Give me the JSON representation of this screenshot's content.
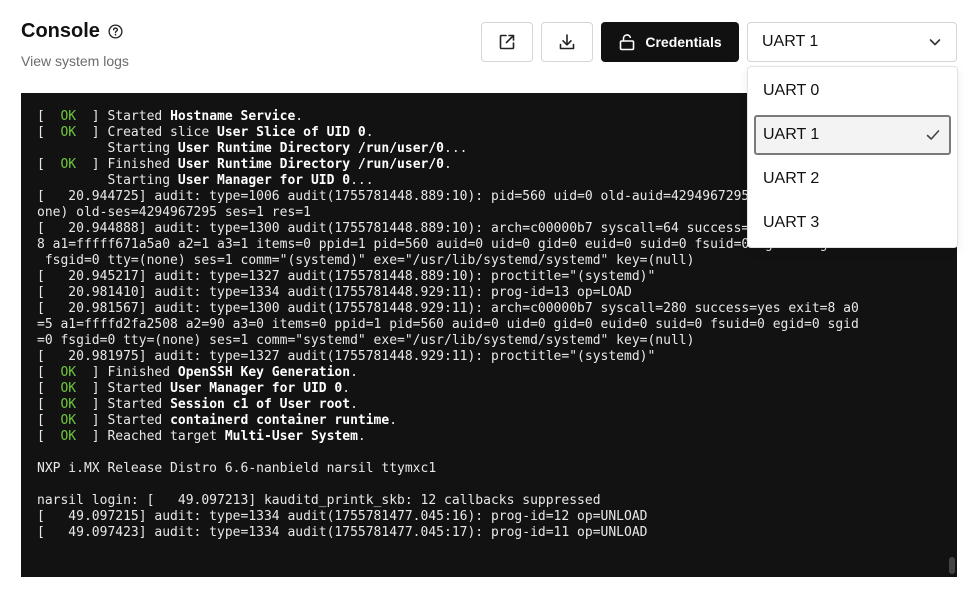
{
  "header": {
    "title": "Console",
    "subtitle": "View system logs"
  },
  "icons": {
    "help": "help-circle-icon",
    "open": "external-link-icon",
    "download": "download-icon",
    "credentials": "unlock-icon",
    "dropdown": "chevron-down-icon",
    "check": "check-icon"
  },
  "toolbar": {
    "credentials_label": "Credentials",
    "port_selected": "UART 1"
  },
  "dropdown": {
    "options": [
      "UART 0",
      "UART 1",
      "UART 2",
      "UART 3"
    ],
    "selected": "UART 1"
  },
  "colors": {
    "ok_green": "#6fc83c",
    "terminal_bg": "#121212",
    "primary_button": "#111111"
  },
  "console": {
    "lines": [
      [
        {
          "t": "[  "
        },
        {
          "t": "OK",
          "s": "ok"
        },
        {
          "t": "  ] Started "
        },
        {
          "t": "Hostname Service",
          "s": "b"
        },
        {
          "t": "."
        }
      ],
      [
        {
          "t": "[  "
        },
        {
          "t": "OK",
          "s": "ok"
        },
        {
          "t": "  ] Created slice "
        },
        {
          "t": "User Slice of UID 0",
          "s": "b"
        },
        {
          "t": "."
        }
      ],
      [
        {
          "t": "         Starting "
        },
        {
          "t": "User Runtime Directory /run/user/0",
          "s": "b"
        },
        {
          "t": "..."
        }
      ],
      [
        {
          "t": "[  "
        },
        {
          "t": "OK",
          "s": "ok"
        },
        {
          "t": "  ] Finished "
        },
        {
          "t": "User Runtime Directory /run/user/0",
          "s": "b"
        },
        {
          "t": "."
        }
      ],
      [
        {
          "t": "         Starting "
        },
        {
          "t": "User Manager for UID 0",
          "s": "b"
        },
        {
          "t": "..."
        }
      ],
      [
        {
          "t": "[   20.944725] audit: type=1006 audit(1755781448.889:10): pid=560 uid=0 old-auid=4294967295 auid=0 tty=(n"
        }
      ],
      [
        {
          "t": "one) old-ses=4294967295 ses=1 res=1"
        }
      ],
      [
        {
          "t": "[   20.944888] audit: type=1300 audit(1755781448.889:10): arch=c00000b7 syscall=64 success=yes exit=1 a0=8"
        }
      ],
      [
        {
          "t": "8 a1=fffff671a5a0 a2=1 a3=1 items=0 ppid=1 pid=560 auid=0 uid=0 gid=0 euid=0 suid=0 fsuid=0 egid=0 sgid=0"
        }
      ],
      [
        {
          "t": " fsgid=0 tty=(none) ses=1 comm=\"(systemd)\" exe=\"/usr/lib/systemd/systemd\" key=(null)"
        }
      ],
      [
        {
          "t": "[   20.945217] audit: type=1327 audit(1755781448.889:10): proctitle=\"(systemd)\""
        }
      ],
      [
        {
          "t": "[   20.981410] audit: type=1334 audit(1755781448.929:11): prog-id=13 op=LOAD"
        }
      ],
      [
        {
          "t": "[   20.981567] audit: type=1300 audit(1755781448.929:11): arch=c00000b7 syscall=280 success=yes exit=8 a0"
        }
      ],
      [
        {
          "t": "=5 a1=ffffd2fa2508 a2=90 a3=0 items=0 ppid=1 pid=560 auid=0 uid=0 gid=0 euid=0 suid=0 fsuid=0 egid=0 sgid"
        }
      ],
      [
        {
          "t": "=0 fsgid=0 tty=(none) ses=1 comm=\"systemd\" exe=\"/usr/lib/systemd/systemd\" key=(null)"
        }
      ],
      [
        {
          "t": "[   20.981975] audit: type=1327 audit(1755781448.929:11): proctitle=\"(systemd)\""
        }
      ],
      [
        {
          "t": "[  "
        },
        {
          "t": "OK",
          "s": "ok"
        },
        {
          "t": "  ] Finished "
        },
        {
          "t": "OpenSSH Key Generation",
          "s": "b"
        },
        {
          "t": "."
        }
      ],
      [
        {
          "t": "[  "
        },
        {
          "t": "OK",
          "s": "ok"
        },
        {
          "t": "  ] Started "
        },
        {
          "t": "User Manager for UID 0",
          "s": "b"
        },
        {
          "t": "."
        }
      ],
      [
        {
          "t": "[  "
        },
        {
          "t": "OK",
          "s": "ok"
        },
        {
          "t": "  ] Started "
        },
        {
          "t": "Session c1 of User root",
          "s": "b"
        },
        {
          "t": "."
        }
      ],
      [
        {
          "t": "[  "
        },
        {
          "t": "OK",
          "s": "ok"
        },
        {
          "t": "  ] Started "
        },
        {
          "t": "containerd container runtime",
          "s": "b"
        },
        {
          "t": "."
        }
      ],
      [
        {
          "t": "[  "
        },
        {
          "t": "OK",
          "s": "ok"
        },
        {
          "t": "  ] Reached target "
        },
        {
          "t": "Multi-User System",
          "s": "b"
        },
        {
          "t": "."
        }
      ],
      [
        {
          "t": ""
        }
      ],
      [
        {
          "t": "NXP i.MX Release Distro 6.6-nanbield narsil ttymxc1"
        }
      ],
      [
        {
          "t": ""
        }
      ],
      [
        {
          "t": "narsil login: [   49.097213] kauditd_printk_skb: 12 callbacks suppressed"
        }
      ],
      [
        {
          "t": "[   49.097215] audit: type=1334 audit(1755781477.045:16): prog-id=12 op=UNLOAD"
        }
      ],
      [
        {
          "t": "[   49.097423] audit: type=1334 audit(1755781477.045:17): prog-id=11 op=UNLOAD"
        }
      ]
    ]
  }
}
